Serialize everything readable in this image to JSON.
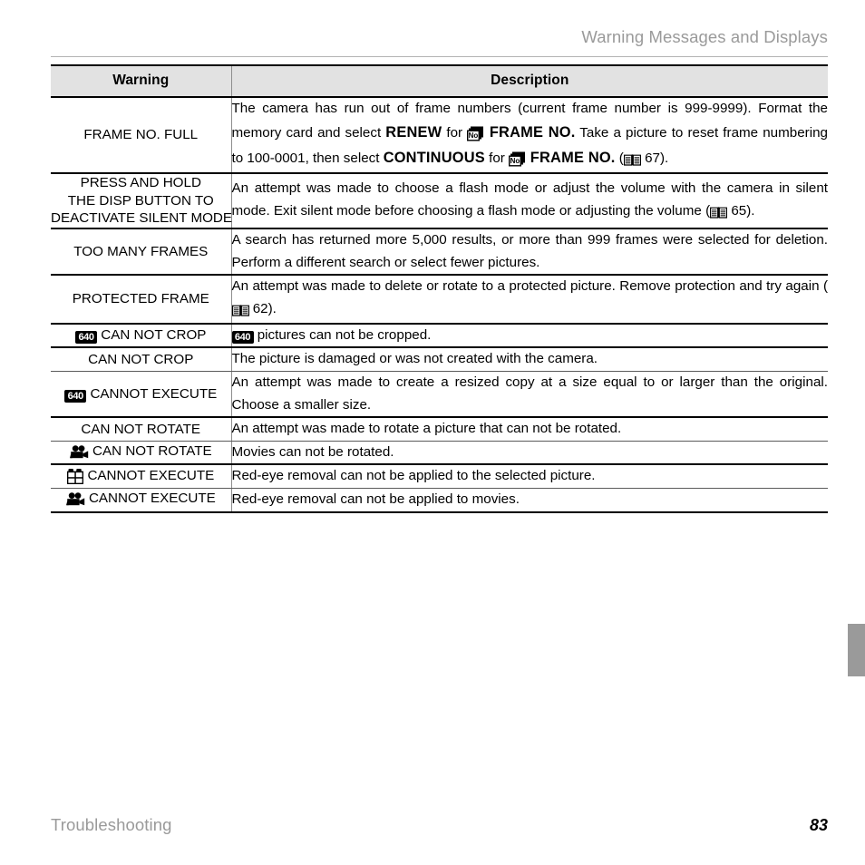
{
  "header": {
    "title": "Warning Messages and Displays"
  },
  "footer": {
    "chapter": "Troubleshooting",
    "page_number": "83"
  },
  "table": {
    "columns": {
      "warning": "Warning",
      "description": "Description"
    },
    "rows": [
      {
        "warning_lines": [
          "FRAME NO. FULL"
        ],
        "warning_icon": "",
        "desc_parts": [
          {
            "type": "text",
            "value": "The camera has run out of frame numbers (current frame number is 999-9999).  Format the memory card and select "
          },
          {
            "type": "bold",
            "value": "RENEW"
          },
          {
            "type": "text",
            "value": " for "
          },
          {
            "type": "icon",
            "value": "frame-no-icon"
          },
          {
            "type": "bold",
            "value": " FRAME NO."
          },
          {
            "type": "text",
            "value": " Take a picture to reset frame numbering to 100-0001, then select "
          },
          {
            "type": "bold",
            "value": "CONTINUOUS"
          },
          {
            "type": "text",
            "value": " for "
          },
          {
            "type": "icon",
            "value": "frame-no-icon"
          },
          {
            "type": "bold",
            "value": " FRAME NO."
          },
          {
            "type": "text",
            "value": " ("
          },
          {
            "type": "icon",
            "value": "book-icon"
          },
          {
            "type": "text",
            "value": " 67)."
          }
        ]
      },
      {
        "warning_lines": [
          "PRESS AND HOLD",
          "THE DISP BUTTON TO",
          "DEACTIVATE SILENT MODE"
        ],
        "warning_icon": "",
        "desc_parts": [
          {
            "type": "text",
            "value": "An attempt was made to choose a flash mode or adjust the volume with the camera in silent mode.  Exit silent mode before choosing a flash mode or adjusting the volume ("
          },
          {
            "type": "icon",
            "value": "book-icon"
          },
          {
            "type": "text",
            "value": " 65)."
          }
        ]
      },
      {
        "warning_lines": [
          "TOO MANY FRAMES"
        ],
        "warning_icon": "",
        "desc_parts": [
          {
            "type": "text",
            "value": "A search has returned more 5,000 results, or more than 999 frames were selected for deletion. Perform a different search or select fewer pictures."
          }
        ]
      },
      {
        "warning_lines": [
          "PROTECTED FRAME"
        ],
        "warning_icon": "",
        "desc_parts": [
          {
            "type": "text",
            "value": "An attempt was made to delete or rotate to a protected picture.  Remove protection and try again ("
          },
          {
            "type": "icon",
            "value": "book-icon"
          },
          {
            "type": "text",
            "value": " 62)."
          }
        ]
      },
      {
        "warning_lines": [
          "CAN NOT CROP"
        ],
        "warning_icon": "size-640-icon",
        "desc_parts": [
          {
            "type": "icon",
            "value": "size-640-icon"
          },
          {
            "type": "text",
            "value": " pictures can not be cropped."
          }
        ]
      },
      {
        "warning_lines": [
          "CAN NOT CROP"
        ],
        "warning_icon": "",
        "desc_parts": [
          {
            "type": "text",
            "value": "The picture is damaged or was not created with the camera."
          }
        ]
      },
      {
        "warning_lines": [
          "CANNOT EXECUTE"
        ],
        "warning_icon": "size-640-icon",
        "desc_parts": [
          {
            "type": "text",
            "value": "An attempt was made to create a resized copy at a size equal to or larger than the original. Choose a smaller size."
          }
        ]
      },
      {
        "warning_lines": [
          "CAN NOT ROTATE"
        ],
        "warning_icon": "",
        "desc_parts": [
          {
            "type": "text",
            "value": "An attempt was made to rotate a picture that can not be rotated."
          }
        ]
      },
      {
        "warning_lines": [
          "CAN NOT ROTATE"
        ],
        "warning_icon": "movie-camera-icon",
        "desc_parts": [
          {
            "type": "text",
            "value": "Movies can not be rotated."
          }
        ]
      },
      {
        "warning_lines": [
          "CANNOT EXECUTE"
        ],
        "warning_icon": "multi-frame-icon",
        "desc_parts": [
          {
            "type": "text",
            "value": "Red-eye removal can not be applied to the selected picture."
          }
        ]
      },
      {
        "warning_lines": [
          "CANNOT EXECUTE"
        ],
        "warning_icon": "movie-camera-icon",
        "desc_parts": [
          {
            "type": "text",
            "value": "Red-eye removal can not be applied to movies."
          }
        ]
      }
    ],
    "thick_underline_rows": [
      0,
      1,
      2,
      3,
      4,
      6,
      8,
      10
    ]
  },
  "icons": {
    "size_640_label": "640"
  },
  "colors": {
    "header_text": "#9a9a9a",
    "rule": "#b3b3b3",
    "table_head_bg": "#e2e2e2",
    "tab_marker": "#9a9a9a",
    "body_text": "#000000"
  }
}
